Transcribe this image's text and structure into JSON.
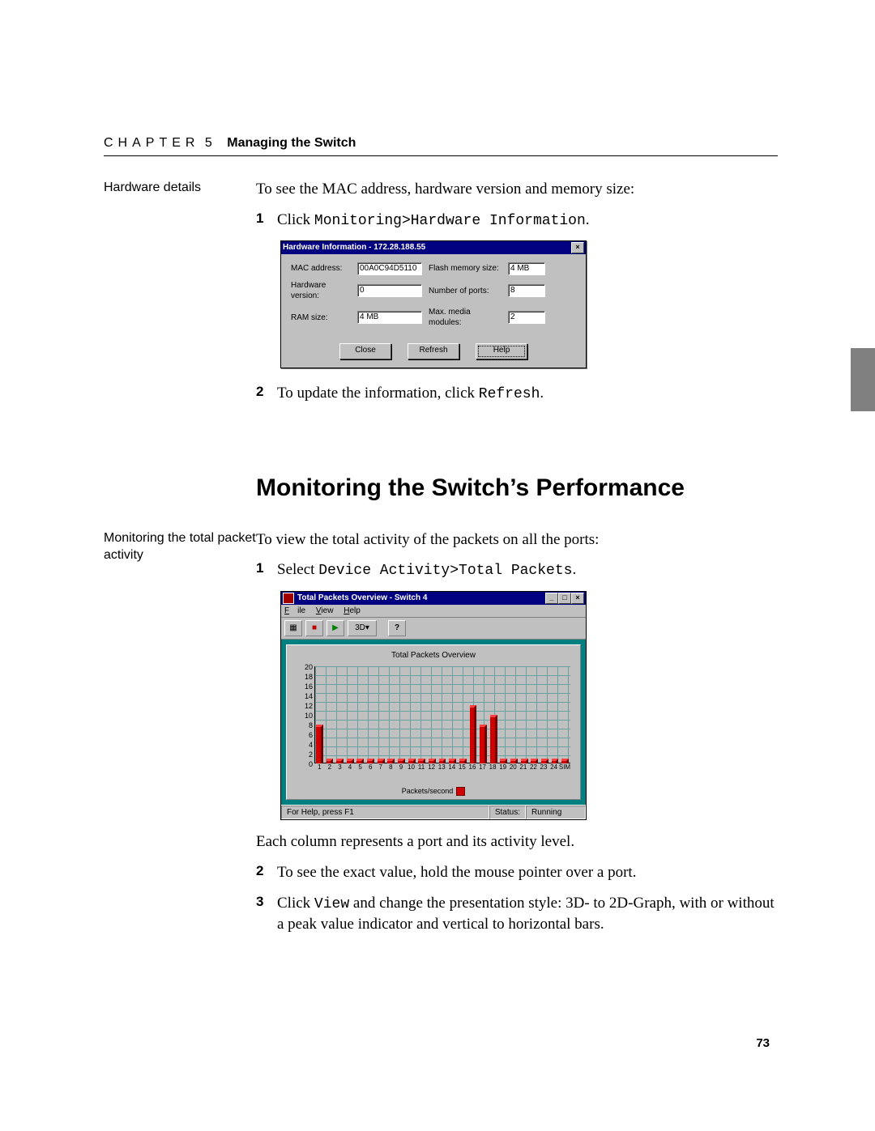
{
  "header": {
    "chapter_word": "CHAPTER",
    "chapter_num": "5",
    "chapter_title": "Managing the Switch"
  },
  "hw_section": {
    "margin_label": "Hardware details",
    "intro": "To see the MAC address, hardware version and memory size:",
    "step1_pre": "Click ",
    "step1_code": "Monitoring>Hardware Information",
    "step1_post": ".",
    "step2_pre": "To update the information, click ",
    "step2_code": "Refresh",
    "step2_post": "."
  },
  "hw_dialog": {
    "title": "Hardware Information - 172.28.188.55",
    "labels": {
      "mac": "MAC address:",
      "hwver": "Hardware version:",
      "ram": "RAM size:",
      "flash": "Flash memory size:",
      "ports": "Number of ports:",
      "media": "Max. media modules:"
    },
    "values": {
      "mac": "00A0C94D5110",
      "hwver": "0",
      "ram": "4 MB",
      "flash": "4 MB",
      "ports": "8",
      "media": "2"
    },
    "buttons": {
      "close": "Close",
      "refresh": "Refresh",
      "help": "Help"
    }
  },
  "perf_section": {
    "heading": "Monitoring the Switch’s Performance",
    "margin_label": "Monitoring the total packet activity",
    "intro": "To view the total activity of the packets on all the ports:",
    "step1_pre": "Select ",
    "step1_code": "Device Activity>Total Packets",
    "step1_post": ".",
    "after1": "Each column represents a port and its activity level.",
    "step2": "To see the exact value, hold the mouse pointer over a port.",
    "step3_pre": "Click ",
    "step3_code": "View",
    "step3_post": " and change the presentation style: 3D- to 2D-Graph, with or without a peak value indicator and vertical to horizontal bars."
  },
  "tp_window": {
    "title": "Total Packets Overview - Switch 4",
    "menu": {
      "file": "File",
      "view": "View",
      "help": "Help"
    },
    "toolbar": {
      "threeD": "3D"
    },
    "panel_title": "Total Packets Overview",
    "legend": "Packets/second",
    "status_left": "For Help, press F1",
    "status_label": "Status:",
    "status_value": "Running"
  },
  "chart_data": {
    "type": "bar",
    "title": "Total Packets Overview",
    "ylabel": "Packets/second",
    "xlabel": "",
    "ylim": [
      0,
      20
    ],
    "yticks": [
      0,
      2,
      4,
      6,
      8,
      10,
      12,
      14,
      16,
      18,
      20
    ],
    "categories": [
      "1",
      "2",
      "3",
      "4",
      "5",
      "6",
      "7",
      "8",
      "9",
      "10",
      "11",
      "12",
      "13",
      "14",
      "15",
      "16",
      "17",
      "18",
      "19",
      "20",
      "21",
      "22",
      "23",
      "24",
      "SIM"
    ],
    "values": [
      8,
      1,
      1,
      1,
      1,
      1,
      1,
      1,
      1,
      1,
      1,
      1,
      1,
      1,
      1,
      12,
      8,
      10,
      1,
      1,
      1,
      1,
      1,
      1,
      1
    ]
  },
  "page_number": "73"
}
